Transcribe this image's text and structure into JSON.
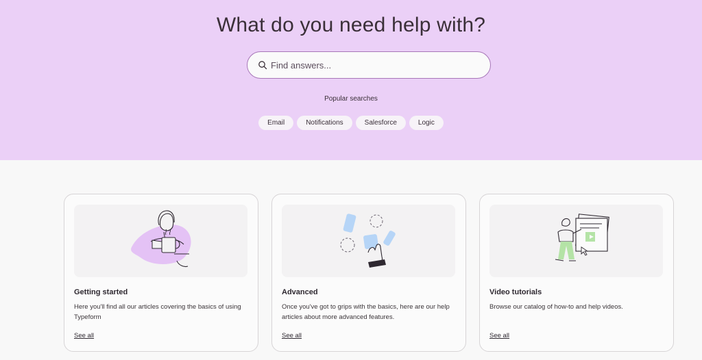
{
  "hero": {
    "title": "What do you need help with?",
    "search_placeholder": "Find answers...",
    "popular_label": "Popular searches",
    "chips": [
      "Email",
      "Notifications",
      "Salesforce",
      "Logic"
    ]
  },
  "cards": [
    {
      "title": "Getting started",
      "description": "Here you'll find all our articles covering the basics of using Typeform",
      "link": "See all",
      "illustration": "person-holding-mug-icon"
    },
    {
      "title": "Advanced",
      "description": "Once you've got to grips with the basics, here are our help articles about more advanced features.",
      "link": "See all",
      "illustration": "hand-with-shapes-icon"
    },
    {
      "title": "Video tutorials",
      "description": "Browse our catalog of how-to and help videos.",
      "link": "See all",
      "illustration": "person-with-screen-icon"
    }
  ],
  "colors": {
    "hero_bg": "#ebd0f7",
    "page_bg": "#f8f8f8",
    "search_border": "#a776b8",
    "accent_purple": "#e4c2f5",
    "accent_blue": "#b6d5f7",
    "accent_green": "#b4e3a6"
  }
}
